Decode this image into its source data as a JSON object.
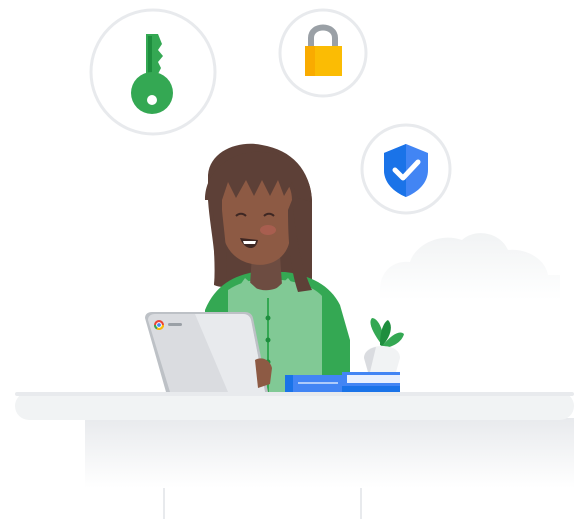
{
  "illustration": {
    "badges": [
      {
        "name": "key-icon",
        "color": "#34a853"
      },
      {
        "name": "lock-icon",
        "color": "#fbbc04"
      },
      {
        "name": "shield-check-icon",
        "color": "#4285f4"
      }
    ],
    "colors": {
      "circle_border": "#e8eaed",
      "hair": "#5d4037",
      "skin": "#8d5a44",
      "shirt": "#34a853",
      "shirt_light": "#81c995",
      "laptop": "#dadce0",
      "book": "#4285f4",
      "plant": "#34a853",
      "desk": "#f1f3f4"
    },
    "laptop_logo": "chrome-logo-icon"
  }
}
